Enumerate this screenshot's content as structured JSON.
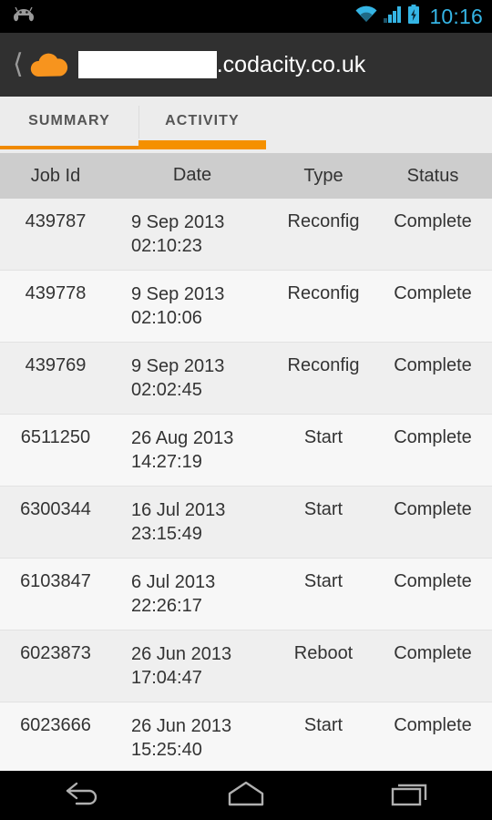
{
  "status_bar": {
    "notification_icon": "android-robot-icon",
    "wifi_icon": "wifi-icon",
    "signal_icon": "cellular-signal-icon",
    "battery_icon": "battery-charging-icon",
    "time": "10:16",
    "accent_color": "#35b5e5"
  },
  "title_bar": {
    "back_icon": "back-chevron-icon",
    "logo_icon": "cloud-icon",
    "logo_color": "#f7941e",
    "redacted_subdomain": "",
    "domain": ".codacity.co.uk",
    "background_color": "#303030"
  },
  "tabs": {
    "items": [
      {
        "label": "SUMMARY",
        "selected": false
      },
      {
        "label": "ACTIVITY",
        "selected": true
      }
    ],
    "indicator_color": "#f59000"
  },
  "table": {
    "columns": [
      "Job Id",
      "Date",
      "Type",
      "Status"
    ],
    "rows": [
      {
        "job_id": "439787",
        "date": "9 Sep 2013",
        "time": "02:10:23",
        "type": "Reconfig",
        "status": "Complete"
      },
      {
        "job_id": "439778",
        "date": "9 Sep 2013",
        "time": "02:10:06",
        "type": "Reconfig",
        "status": "Complete"
      },
      {
        "job_id": "439769",
        "date": "9 Sep 2013",
        "time": "02:02:45",
        "type": "Reconfig",
        "status": "Complete"
      },
      {
        "job_id": "6511250",
        "date": "26 Aug 2013",
        "time": "14:27:19",
        "type": "Start",
        "status": "Complete"
      },
      {
        "job_id": "6300344",
        "date": "16 Jul 2013",
        "time": "23:15:49",
        "type": "Start",
        "status": "Complete"
      },
      {
        "job_id": "6103847",
        "date": "6 Jul 2013",
        "time": "22:26:17",
        "type": "Start",
        "status": "Complete"
      },
      {
        "job_id": "6023873",
        "date": "26 Jun 2013",
        "time": "17:04:47",
        "type": "Reboot",
        "status": "Complete"
      },
      {
        "job_id": "6023666",
        "date": "26 Jun 2013",
        "time": "15:25:40",
        "type": "Start",
        "status": "Complete"
      }
    ]
  },
  "nav_bar": {
    "back_icon": "back-arrow-icon",
    "home_icon": "home-icon",
    "recents_icon": "recent-apps-icon"
  }
}
